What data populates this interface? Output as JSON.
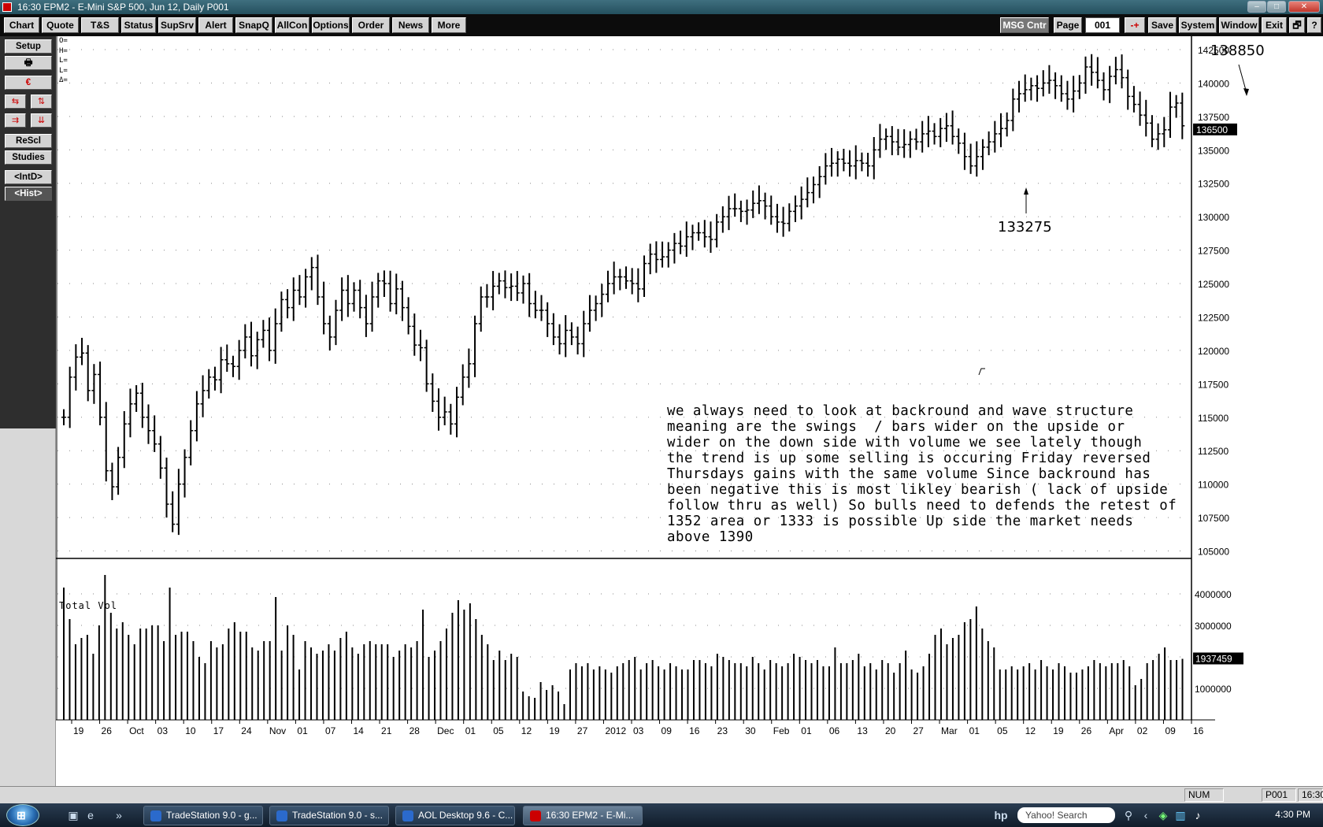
{
  "window": {
    "title": "16:30   EPM2 - E-Mini S&P 500, Jun 12, Daily   P001"
  },
  "toolbar": {
    "buttons": [
      "Chart",
      "Quote",
      "T&S",
      "Status",
      "SupSrv",
      "Alert",
      "SnapQ",
      "AllCon",
      "Options",
      "Order",
      "News",
      "More"
    ],
    "right": {
      "msg": "MSG Cntr",
      "page_label": "Page",
      "page_value": "001",
      "minus_plus": "-+",
      "save": "Save",
      "system": "System",
      "window": "Window",
      "exit": "Exit",
      "restore": "🗗",
      "help": "?"
    }
  },
  "sidebar": {
    "setup": "Setup",
    "print_icon": "printer-icon",
    "rescl": "ReScl",
    "studies": "Studies",
    "intd": "<IntD>",
    "hist": "<Hist>"
  },
  "chart": {
    "ohlc_labels": [
      "O=",
      "H=",
      "L=",
      "L=",
      "Δ="
    ],
    "commentary": "we always need to look at backround and wave structure\nmeaning are the swings  / bars wider on the upside or\nwider on the down side with volume we see lately though\nthe trend is up some selling is occuring Friday reversed\nThursdays gains with the same volume Since backround has\nbeen negative this is most likley bearish ( lack of upside\nfollow thru as well) So bulls need to defends the retest of\n1352 area or 1333 is possible Up side the market needs\nabove 1390",
    "annotation_high": "138850",
    "annotation_low": "133275",
    "volume_label": "Total Vol"
  },
  "chart_data": [
    {
      "type": "ohlc",
      "series": [
        {
          "name": "EPM2 - E-Mini S&P 500, Jun 12, Daily"
        }
      ],
      "ylim": [
        104500,
        143500
      ],
      "y_ticks": [
        105000,
        107500,
        110000,
        112500,
        115000,
        117500,
        120000,
        122500,
        125000,
        127500,
        130000,
        132500,
        135000,
        137500,
        140000,
        142500
      ],
      "last_price": "136500",
      "x_tick_labels": [
        "19",
        "26",
        "Oct",
        "03",
        "10",
        "17",
        "24",
        "Nov",
        "01",
        "07",
        "14",
        "21",
        "28",
        "Dec",
        "01",
        "05",
        "12",
        "19",
        "27",
        "2012",
        "03",
        "09",
        "16",
        "23",
        "30",
        "Feb",
        "01",
        "06",
        "13",
        "20",
        "27",
        "Mar",
        "01",
        "05",
        "12",
        "19",
        "26",
        "Apr",
        "02",
        "09",
        "16"
      ],
      "close": [
        1150,
        1180,
        1195,
        1198,
        1170,
        1182,
        1150,
        1110,
        1098,
        1120,
        1145,
        1160,
        1168,
        1150,
        1140,
        1130,
        1112,
        1085,
        1070,
        1100,
        1120,
        1140,
        1160,
        1170,
        1180,
        1178,
        1193,
        1190,
        1188,
        1200,
        1210,
        1196,
        1208,
        1215,
        1200,
        1220,
        1238,
        1232,
        1245,
        1240,
        1255,
        1262,
        1240,
        1220,
        1210,
        1230,
        1245,
        1235,
        1245,
        1232,
        1220,
        1240,
        1252,
        1250,
        1235,
        1246,
        1232,
        1218,
        1204,
        1202,
        1175,
        1162,
        1150,
        1154,
        1145,
        1165,
        1180,
        1190,
        1220,
        1240,
        1240,
        1248,
        1252,
        1247,
        1248,
        1243,
        1250,
        1235,
        1230,
        1230,
        1220,
        1210,
        1205,
        1215,
        1210,
        1205,
        1220,
        1230,
        1235,
        1242,
        1250,
        1255,
        1255,
        1252,
        1250,
        1246,
        1265,
        1272,
        1268,
        1270,
        1275,
        1280,
        1278,
        1285,
        1288,
        1288,
        1285,
        1283,
        1296,
        1300,
        1306,
        1306,
        1304,
        1305,
        1310,
        1312,
        1308,
        1300,
        1296,
        1295,
        1304,
        1308,
        1313,
        1318,
        1324,
        1330,
        1338,
        1340,
        1343,
        1340,
        1338,
        1342,
        1340,
        1338,
        1350,
        1358,
        1360,
        1356,
        1352,
        1354,
        1358,
        1356,
        1362,
        1364,
        1360,
        1366,
        1368,
        1360,
        1355,
        1345,
        1338,
        1345,
        1352,
        1356,
        1362,
        1366,
        1372,
        1388,
        1392,
        1395,
        1398,
        1396,
        1400,
        1402,
        1398,
        1392,
        1388,
        1394,
        1400,
        1412,
        1408,
        1402,
        1395,
        1405,
        1410,
        1404,
        1390,
        1384,
        1376,
        1370,
        1358,
        1362,
        1365,
        1382,
        1385,
        1368
      ]
    },
    {
      "type": "bar",
      "series": [
        {
          "name": "Total Vol"
        }
      ],
      "ylim": [
        0,
        4600000
      ],
      "y_ticks": [
        1000000,
        2000000,
        3000000,
        4000000
      ],
      "last_value": "1937459",
      "values": [
        4200000,
        3200000,
        2400000,
        2600000,
        2700000,
        2100000,
        3000000,
        4600000,
        3400000,
        2900000,
        3100000,
        2700000,
        2400000,
        2900000,
        2900000,
        3000000,
        3000000,
        2500000,
        4200000,
        2700000,
        2800000,
        2800000,
        2500000,
        2000000,
        1800000,
        2500000,
        2300000,
        2400000,
        2900000,
        3100000,
        2800000,
        2800000,
        2300000,
        2200000,
        2500000,
        2500000,
        3900000,
        2200000,
        3000000,
        2700000,
        1600000,
        2500000,
        2300000,
        2100000,
        2200000,
        2400000,
        2200000,
        2600000,
        2800000,
        2300000,
        2100000,
        2400000,
        2500000,
        2400000,
        2400000,
        2400000,
        2000000,
        2200000,
        2400000,
        2300000,
        2500000,
        3500000,
        2000000,
        2200000,
        2500000,
        2900000,
        3400000,
        3800000,
        3500000,
        3700000,
        3200000,
        2700000,
        2400000,
        1900000,
        2200000,
        1900000,
        2100000,
        2000000,
        900000,
        750000,
        700000,
        1200000,
        950000,
        1100000,
        900000,
        500000,
        1600000,
        1800000,
        1700000,
        1800000,
        1600000,
        1700000,
        1600000,
        1500000,
        1700000,
        1800000,
        1900000,
        2000000,
        1600000,
        1800000,
        1900000,
        1700000,
        1600000,
        1800000,
        1700000,
        1600000,
        1600000,
        1900000,
        1900000,
        1800000,
        1700000,
        2100000,
        2000000,
        1900000,
        1800000,
        1800000,
        1700000,
        2000000,
        1800000,
        1600000,
        1900000,
        1800000,
        1700000,
        1800000,
        2100000,
        2000000,
        1900000,
        1800000,
        1900000,
        1700000,
        1700000,
        2300000,
        1800000,
        1800000,
        1900000,
        2100000,
        1700000,
        1800000,
        1600000,
        1900000,
        1800000,
        1500000,
        1800000,
        2200000,
        1600000,
        1500000,
        1700000,
        2100000,
        2700000,
        2900000,
        2400000,
        2600000,
        2700000,
        3100000,
        3200000,
        3600000,
        2900000,
        2500000,
        2300000,
        1600000,
        1600000,
        1700000,
        1600000,
        1700000,
        1800000,
        1600000,
        1900000,
        1700000,
        1600000,
        1800000,
        1700000,
        1500000,
        1500000,
        1600000,
        1700000,
        1900000,
        1800000,
        1700000,
        1800000,
        1800000,
        1900000,
        1700000,
        1100000,
        1300000,
        1800000,
        1900000,
        2100000,
        2300000,
        1900000,
        1900000,
        1937459
      ]
    }
  ],
  "statusbar": {
    "num": "NUM",
    "page": "P001",
    "time": "16:30"
  },
  "taskbar": {
    "start": "start-orb-icon",
    "tasks": [
      "TradeStation 9.0 - g...",
      "TradeStation 9.0 - s...",
      "AOL Desktop 9.6 - C...",
      "16:30   EPM2 - E-Mi..."
    ],
    "search_placeholder": "Yahoo! Search",
    "clock": "4:30 PM"
  },
  "colors": {
    "toolbar_bg": "#0c0c0c",
    "sidebar_bg": "#2e2e2e",
    "bar_color": "#000000",
    "highlight_label_bg": "#000000"
  }
}
